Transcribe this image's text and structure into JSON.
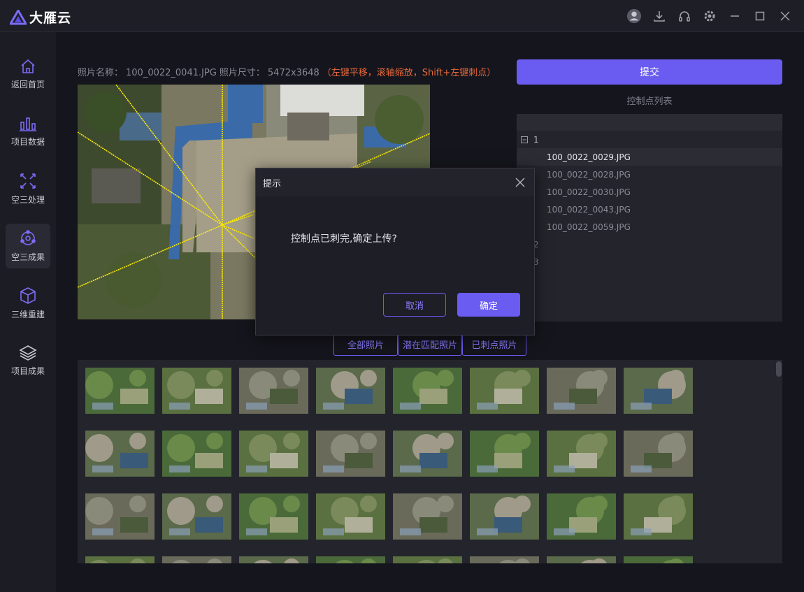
{
  "app": {
    "name": "大雁云"
  },
  "sidebar": {
    "items": [
      {
        "label": "返回首页",
        "icon": "home-icon"
      },
      {
        "label": "项目数据",
        "icon": "bar-chart-icon"
      },
      {
        "label": "空三处理",
        "icon": "cross-arrows-icon"
      },
      {
        "label": "空三成果",
        "icon": "orbit-icon",
        "active": true
      },
      {
        "label": "三维重建",
        "icon": "cube-icon"
      },
      {
        "label": "项目成果",
        "icon": "layers-icon"
      }
    ]
  },
  "photo": {
    "name_label": "照片名称：",
    "name_value": "100_0022_0041.JPG",
    "size_label": "照片尺寸：",
    "size_value": "5472x3648",
    "hint": "（左键平移，滚轴缩放，Shift+左键刺点）"
  },
  "submit_label": "提交",
  "control_points": {
    "title": "控制点列表",
    "groups": [
      {
        "id": "1",
        "expanded": true,
        "files": [
          "100_0022_0029.JPG",
          "100_0022_0028.JPG",
          "100_0022_0030.JPG",
          "100_0022_0043.JPG",
          "100_0022_0059.JPG"
        ]
      },
      {
        "id": "2"
      },
      {
        "id": "3"
      }
    ]
  },
  "tabs": [
    "全部照片",
    "潜在匹配照片",
    "已刺点照片"
  ],
  "dialog": {
    "title": "提示",
    "message": "控制点已刺完,确定上传?",
    "cancel": "取消",
    "confirm": "确定"
  },
  "colors": {
    "accent": "#6a5cf0",
    "hint": "#e86a3a"
  }
}
